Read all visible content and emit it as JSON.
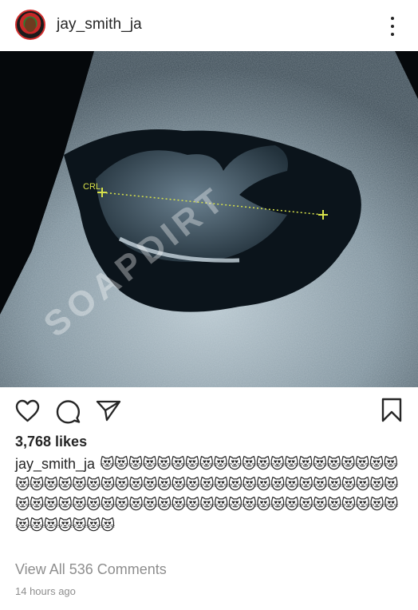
{
  "header": {
    "username": "jay_smith_ja",
    "avatar_icon": "profile-avatar-icon",
    "more_icon": "more-options-icon"
  },
  "photo": {
    "overlay_label": "CRL",
    "watermark": "SOAPDIRT"
  },
  "actions": {
    "like_icon": "heart-outline-icon",
    "comment_icon": "comment-bubble-icon",
    "share_icon": "paper-plane-icon",
    "save_icon": "bookmark-outline-icon"
  },
  "post": {
    "likes": "3,768 likes",
    "caption_user": "jay_smith_ja",
    "caption_text": "😻😻😻😻😻😻😻😻😻😻😻😻😻😻😻😻😻😻😻😻😻😻😻😻😻😻😻😻😻😻😻😻😻😻😻😻😻😻😻😻😻😻😻😻😻😻😻😻😻😻😻😻😻😻😻😻😻😻😻😻😻😻😻😻😻😻😻😻😻😻😻😻😻😻😻😻😻😻😻😻😻😻",
    "view_all_comments": "View All 536 Comments",
    "timestamp": "14 hours ago"
  },
  "colors": {
    "text": "#262626",
    "muted": "#8e8e8e",
    "marker": "#d8e24a"
  }
}
